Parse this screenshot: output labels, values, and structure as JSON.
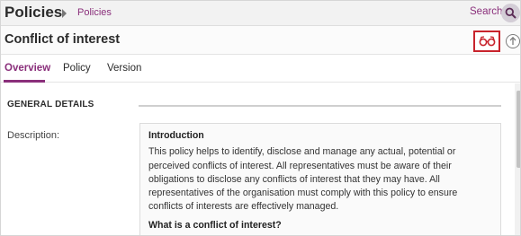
{
  "topbar": {
    "app_title": "Policies",
    "breadcrumb_link": "Policies",
    "search_label": "Search"
  },
  "header": {
    "title": "Conflict of interest"
  },
  "tabs": [
    {
      "label": "Overview",
      "active": true
    },
    {
      "label": "Policy",
      "active": false
    },
    {
      "label": "Version",
      "active": false
    }
  ],
  "section": {
    "heading": "GENERAL DETAILS",
    "description_label": "Description:",
    "description": {
      "heading": "Introduction",
      "paragraph": "This policy helps to identify, disclose and manage any actual, potential or perceived conflicts of interest. All representatives must be aware of their obligations to disclose any conflicts of interest that they may have. All representatives of the organisation must comply with this policy to ensure conflicts of interests are effectively managed.",
      "subheading": "What is a conflict of interest?"
    }
  },
  "icons": {
    "breadcrumb_separator": "chevron-right-icon",
    "search": "search-icon",
    "view": "glasses-icon",
    "upload": "upload-icon"
  },
  "colors": {
    "accent": "#8a2f7b",
    "highlight_border": "#c8232c",
    "topbar_bg": "#f2f2f2"
  }
}
